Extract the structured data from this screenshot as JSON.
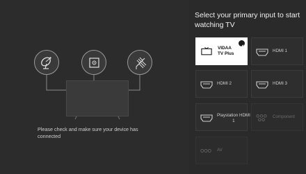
{
  "heading": "Select your primary input to start watching TV",
  "diagram": {
    "icons": [
      "satellite-dish-icon",
      "set-top-box-icon",
      "antenna-icon"
    ],
    "message": "Please check and make sure your device has connected"
  },
  "inputs": [
    {
      "label": "VIDAA TV Plus",
      "icon": "tv-icon",
      "selected": true,
      "enabled": true
    },
    {
      "label": "HDMI 1",
      "icon": "hdmi-icon",
      "selected": false,
      "enabled": true
    },
    {
      "label": "HDMI 2",
      "icon": "hdmi-icon",
      "selected": false,
      "enabled": true
    },
    {
      "label": "HDMI 3",
      "icon": "hdmi-icon",
      "selected": false,
      "enabled": true
    },
    {
      "label": "Playstation HDMI 1",
      "icon": "hdmi-icon",
      "selected": false,
      "enabled": true
    },
    {
      "label": "Component",
      "icon": "component-icon",
      "selected": false,
      "enabled": false
    },
    {
      "label": "AV",
      "icon": "av-icon",
      "selected": false,
      "enabled": false
    }
  ],
  "colors": {
    "background": "#2c2c2c",
    "tile": "#2e2e2e",
    "tile_selected": "#ffffff",
    "text": "#d0d0d0",
    "text_disabled": "#6a6a6a"
  }
}
